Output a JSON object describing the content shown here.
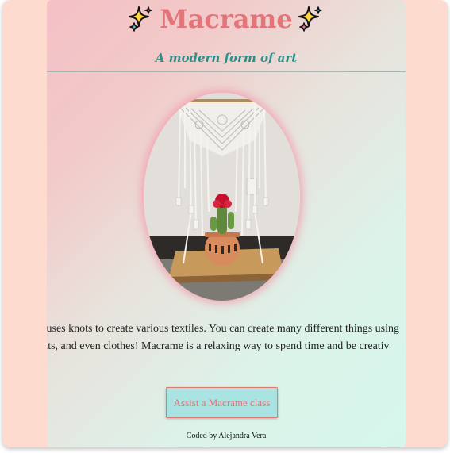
{
  "header": {
    "title": "Macrame",
    "subtitle": "A modern form of art",
    "title_icon": "sparkles-icon"
  },
  "main": {
    "image": {
      "icon": "macrame-wall-hanging-photo"
    },
    "description_line_1": "that uses knots to create various textiles. You can create many different things using",
    "description_line_2": "ses, belts, and even clothes! Macrame is a relaxing way to spend time and be creativ",
    "cta_label": "Assist a Macrame class"
  },
  "footer": {
    "credit": "Coded by Alejandra Vera"
  },
  "colors": {
    "title": "#e2747a",
    "subtitle": "#2e8f8a",
    "button_bg": "#a9e3e2",
    "button_border": "#e07b72",
    "page_bg": "#fddccf"
  }
}
